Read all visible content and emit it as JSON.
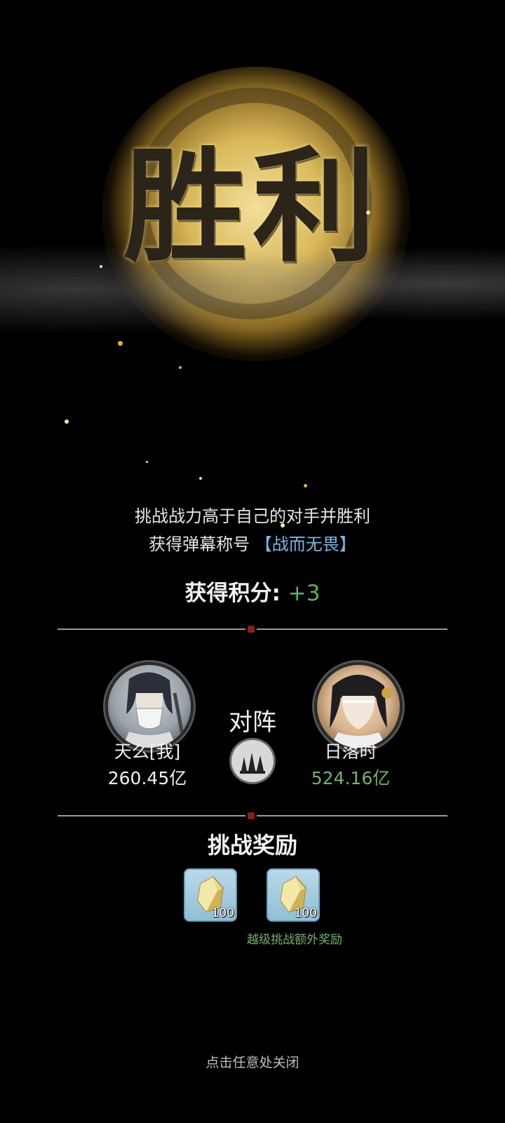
{
  "banner": {
    "title": "胜利"
  },
  "description": {
    "line1": "挑战战力高于自己的对手并胜利",
    "line2_prefix": "获得弹幕称号",
    "line2_title": "【战而无畏】"
  },
  "score": {
    "label": "获得积分:",
    "value": "+3"
  },
  "matchup": {
    "vs_label": "对阵",
    "player": {
      "name": "天么[我]",
      "power": "260.45亿",
      "power_color": "#ffffff"
    },
    "opponent": {
      "name": "日落时",
      "power": "524.16亿",
      "power_color": "#6fb46a"
    }
  },
  "rewards": {
    "title": "挑战奖励",
    "items": [
      {
        "icon": "crystal-icon",
        "quantity": "100"
      },
      {
        "icon": "crystal-icon",
        "quantity": "100"
      }
    ],
    "bonus_note": "越级挑战额外奖励"
  },
  "close_hint": "点击任意处关闭",
  "colors": {
    "accent_blue": "#7fb4e8",
    "accent_green": "#5fb05a",
    "background": "#000000"
  }
}
